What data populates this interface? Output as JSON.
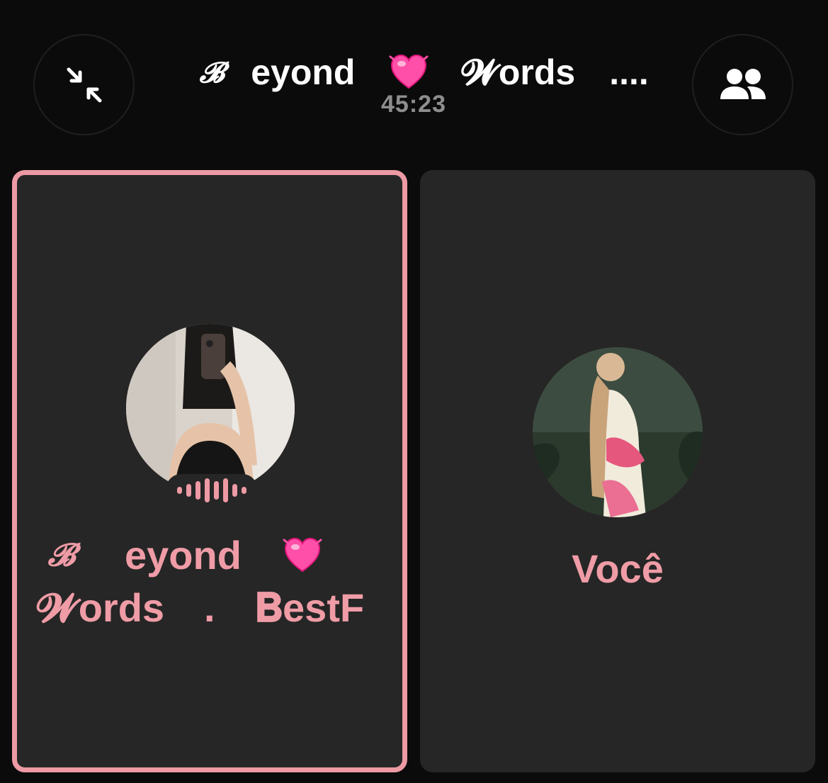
{
  "header": {
    "minimize_icon": "minimize-arrows-icon",
    "people_icon": "people-icon",
    "title_parts": [
      "𝓑",
      "eyond",
      "💓",
      "𝓦ords",
      "...."
    ],
    "timer": "45:23"
  },
  "participants": [
    {
      "name_line1": [
        "𝓑",
        "eyond",
        "💓"
      ],
      "name_line2": [
        "𝓦ords",
        ".",
        "𝐁estF"
      ],
      "speaking": true,
      "avatar": "participant-photo"
    },
    {
      "name": "Você",
      "speaking": false,
      "avatar": "self-photo"
    }
  ],
  "colors": {
    "accent": "#ed9aa5",
    "background": "#0b0b0b",
    "tile": "#262626",
    "timer": "#8e8e8e"
  }
}
